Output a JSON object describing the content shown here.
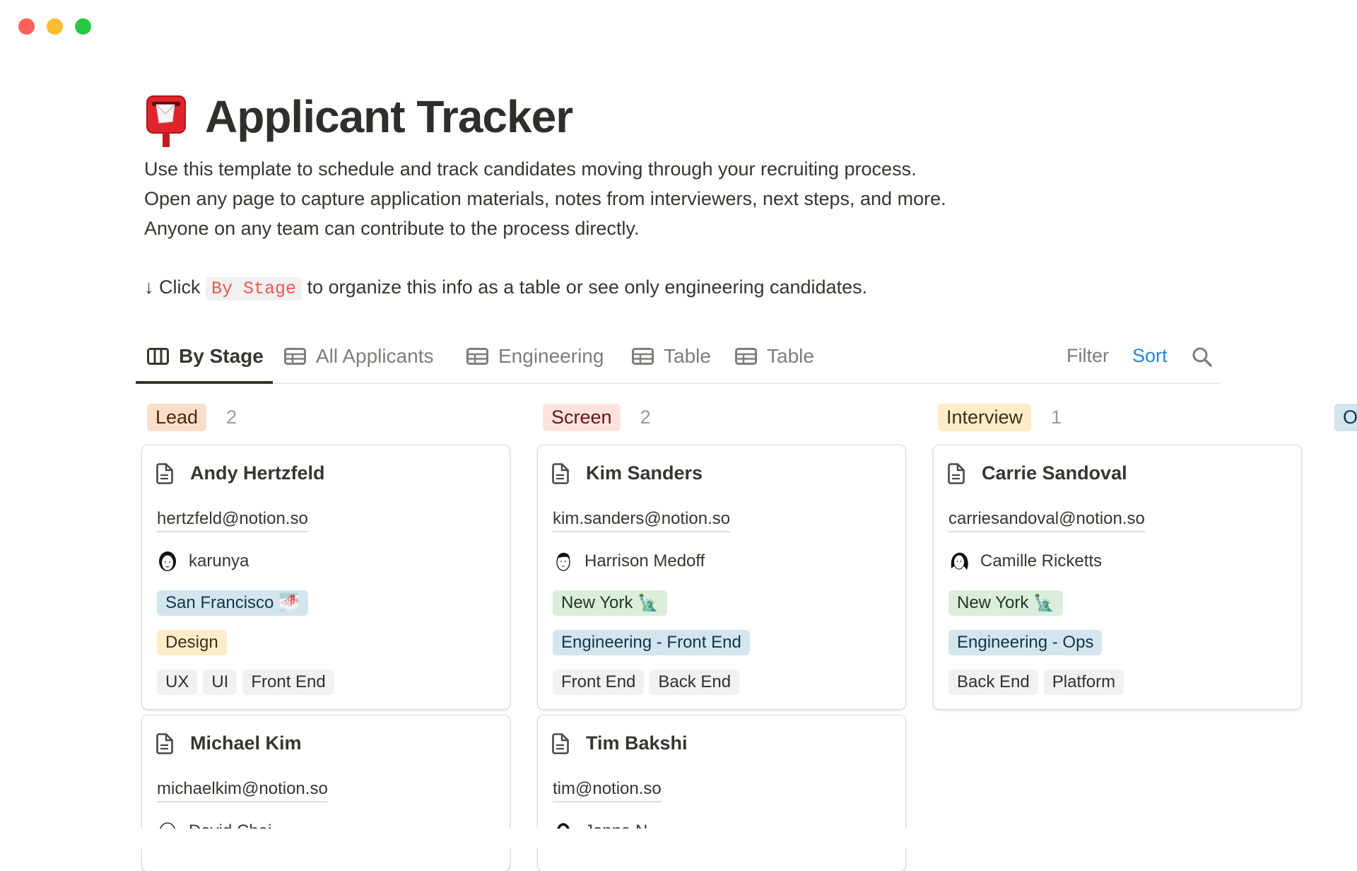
{
  "window": {
    "controls": [
      {
        "name": "close",
        "color": "#ff5f57"
      },
      {
        "name": "minimize",
        "color": "#febc2e"
      },
      {
        "name": "zoom",
        "color": "#28c840"
      }
    ]
  },
  "page": {
    "icon": "postbox-emoji",
    "title": "Applicant Tracker",
    "description": [
      "Use this template to schedule and track candidates moving through your recruiting process.",
      "Open any page to capture application materials, notes from interviewers, next steps, and more.",
      "Anyone on any team can contribute to the process directly."
    ],
    "hint": {
      "arrow": "↓",
      "before": "Click",
      "code": "By Stage",
      "after": "to organize this info as a table or see only engineering candidates."
    }
  },
  "views": {
    "tabs": [
      {
        "label": "By Stage",
        "icon": "board-icon",
        "active": true
      },
      {
        "label": "All Applicants",
        "icon": "table-icon",
        "active": false
      },
      {
        "label": "Engineering",
        "icon": "table-icon",
        "active": false
      },
      {
        "label": "Table",
        "icon": "table-icon",
        "active": false
      },
      {
        "label": "Table",
        "icon": "table-icon",
        "active": false
      }
    ],
    "filter_label": "Filter",
    "sort_label": "Sort",
    "search_icon": "search-icon",
    "accent_color": "#2383e2"
  },
  "board": {
    "groups": [
      {
        "stage": "Lead",
        "count": "2",
        "bg": "#fadec9",
        "fg": "#49290e",
        "cards": [
          {
            "name": "Andy Hertzfeld",
            "email": "hertzfeld@notion.so",
            "interviewer": "karunya",
            "location": "San Francisco 🌁",
            "location_color": "blue",
            "department": "Design",
            "department_color": "yellow",
            "skills": [
              "UX",
              "UI",
              "Front End"
            ]
          },
          {
            "name": "Michael Kim",
            "email": "michaelkim@notion.so",
            "interviewer": "David Chai"
          }
        ]
      },
      {
        "stage": "Screen",
        "count": "2",
        "bg": "#ffe2dd",
        "fg": "#5d1715",
        "cards": [
          {
            "name": "Kim Sanders",
            "email": "kim.sanders@notion.so",
            "interviewer": "Harrison Medoff",
            "location": "New York 🗽",
            "location_color": "green",
            "department": "Engineering - Front End",
            "department_color": "blue",
            "skills": [
              "Front End",
              "Back End"
            ]
          },
          {
            "name": "Tim Bakshi",
            "email": "tim@notion.so",
            "interviewer": "Jenna N"
          }
        ]
      },
      {
        "stage": "Interview",
        "count": "1",
        "bg": "#fdecc8",
        "fg": "#402c1b",
        "cards": [
          {
            "name": "Carrie Sandoval",
            "email": "carriesandoval@notion.so",
            "interviewer": "Camille Ricketts",
            "location": "New York 🗽",
            "location_color": "green",
            "department": "Engineering - Ops",
            "department_color": "blue",
            "skills": [
              "Back End",
              "Platform"
            ]
          }
        ]
      },
      {
        "stage": "O",
        "bg": "#d3e5ef",
        "fg": "#183347"
      }
    ]
  },
  "colors": {
    "blue": {
      "bg": "#d3e5ef",
      "fg": "#183347"
    },
    "green": {
      "bg": "#dbeddb",
      "fg": "#1c3829"
    },
    "yellow": {
      "bg": "#fdecc8",
      "fg": "#402c1b"
    },
    "gray": {
      "bg": "#f1f1ef",
      "fg": "#32302c"
    }
  }
}
